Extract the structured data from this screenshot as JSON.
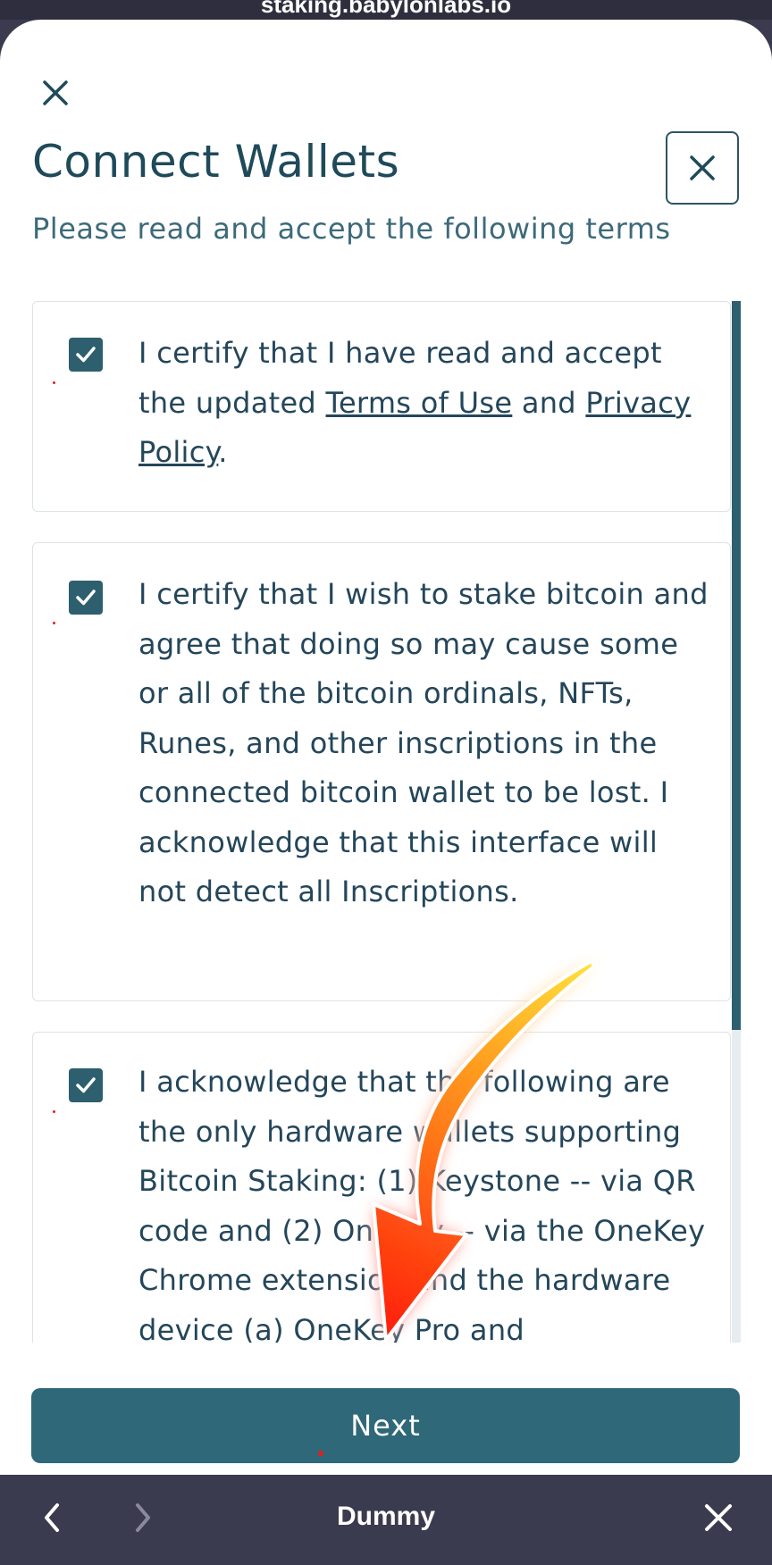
{
  "browser": {
    "url": "staking.babylonlabs.io"
  },
  "modal": {
    "title": "Connect Wallets",
    "subtitle": "Please read and accept the following terms",
    "terms": [
      {
        "checked": true,
        "text_before_link1": "I certify that I have read and accept the updated ",
        "link1": "Terms of Use",
        "text_between": " and ",
        "link2": "Privacy Policy",
        "text_after": "."
      },
      {
        "checked": true,
        "text": "I certify that I wish to stake bitcoin and agree that doing so may cause some or all of the bitcoin ordinals, NFTs, Runes, and other inscriptions in the connected bitcoin wallet to be lost. I acknowledge that this interface will not detect all Inscriptions."
      },
      {
        "checked": true,
        "text": "I acknowledge that the following are the only hardware wallets supporting Bitcoin Staking: (1) Keystone -- via QR code and (2) OneKey -- via the OneKey Chrome extension and the hardware device (a) OneKey Pro and"
      }
    ],
    "next_label": "Next"
  },
  "bottom_bar": {
    "title": "Dummy"
  },
  "colors": {
    "primary": "#2f6878",
    "title_text": "#1f4a5a",
    "bottom_bar": "#3b3b4f"
  },
  "icons": {
    "close": "close-icon",
    "modal_close": "close-icon",
    "checkbox": "checkmark-icon",
    "back": "chevron-left-icon",
    "forward": "chevron-right-icon",
    "bottom_close": "close-icon",
    "overlay": "arrow-annotation-icon"
  }
}
